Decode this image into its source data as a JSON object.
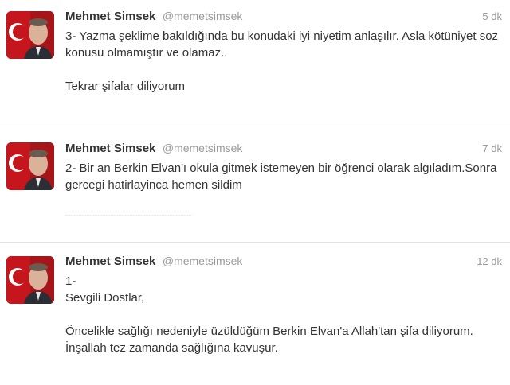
{
  "tweets": [
    {
      "name": "Mehmet Simsek",
      "handle": "@memetsimsek",
      "time": "5 dk",
      "paragraphs": [
        "3- Yazma şeklime bakıldığında bu konudaki iyi niyetim anlaşılır. Asla kötüniyet soz konusu olmamıştır ve olamaz..",
        "Tekrar şifalar diliyorum"
      ]
    },
    {
      "name": "Mehmet Simsek",
      "handle": "@memetsimsek",
      "time": "7 dk",
      "paragraphs": [
        "2- Bir an Berkin Elvan'ı okula gitmek istemeyen bir öğrenci olarak algıladım.Sonra gercegi hatirlayinca hemen sildim"
      ]
    },
    {
      "name": "Mehmet Simsek",
      "handle": "@memetsimsek",
      "time": "12 dk",
      "paragraphs": [
        "1-\nSevgili Dostlar,",
        "Öncelikle sağlığı nedeniyle üzüldüğüm Berkin Elvan'a Allah'tan şifa diliyorum. İnşallah tez zamanda sağlığına kavuşur."
      ]
    }
  ],
  "colors": {
    "text": "#333333",
    "muted": "#999999",
    "divider": "#dfe3e6",
    "flag_red": "#c4161c"
  },
  "icons": {
    "avatar": "profile-photo-with-turkish-flag"
  }
}
